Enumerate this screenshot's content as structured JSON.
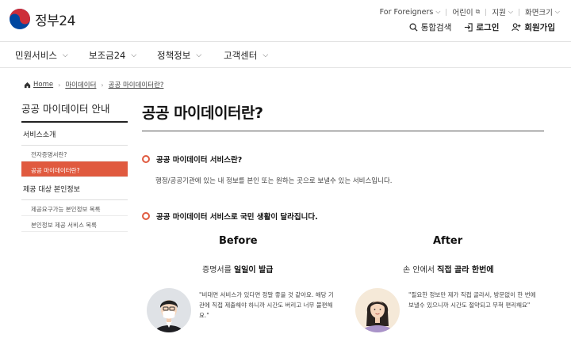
{
  "header": {
    "logo_text": "정부24",
    "util": {
      "foreigners": "For Foreigners",
      "kids": "어린이",
      "support": "지원",
      "screen_size": "화면크기"
    },
    "actions": {
      "search": "통합검색",
      "login": "로그인",
      "signup": "회원가입"
    }
  },
  "nav": {
    "items": [
      "민원서비스",
      "보조금24",
      "정책정보",
      "고객센터"
    ]
  },
  "breadcrumb": {
    "home": "Home",
    "level1": "마이데이터",
    "level2": "공공 마이데이터란?"
  },
  "sidebar": {
    "title": "공공 마이데이터 안내",
    "sections": [
      {
        "label": "서비스소개",
        "items": [
          {
            "label": "전자증명서란?",
            "active": false
          },
          {
            "label": "공공 마이데이터란?",
            "active": true
          }
        ]
      },
      {
        "label": "제공 대상 본인정보",
        "items": [
          {
            "label": "제공요구가능 본인정보 목록",
            "active": false
          },
          {
            "label": "본인정보 제공 서비스 목록",
            "active": false
          }
        ]
      }
    ]
  },
  "main": {
    "title": "공공 마이데이터란?",
    "q1": "공공 마이데이터 서비스란?",
    "a1": "행정/공공기관에 있는 내 정보를 본인 또는 원하는 곳으로 보낼수 있는 서비스입니다.",
    "q2": "공공 마이데이터 서비스로 국민 생활이 달라집니다.",
    "before": {
      "heading": "Before",
      "sub_plain": "증명서를 ",
      "sub_bold": "일일이 발급",
      "quote": "\"비대면 서비스가 있다면 정말 좋을 것 같아요. 해당 기관에 직접 제출해야 하니까 시간도 버리고 너무 불편해요.\""
    },
    "after": {
      "heading": "After",
      "sub_plain": "손 안에서 ",
      "sub_bold": "직접 골라 한번에",
      "quote": "\"필요한 정보만 제가 직접 골라서, 방문없이 한 번에 보낼수 있으니까 시간도 절약되고 무척 편리해요\""
    }
  },
  "colors": {
    "accent": "#e05a3f",
    "logo_red": "#cd2e3a",
    "logo_blue": "#0047a0"
  }
}
